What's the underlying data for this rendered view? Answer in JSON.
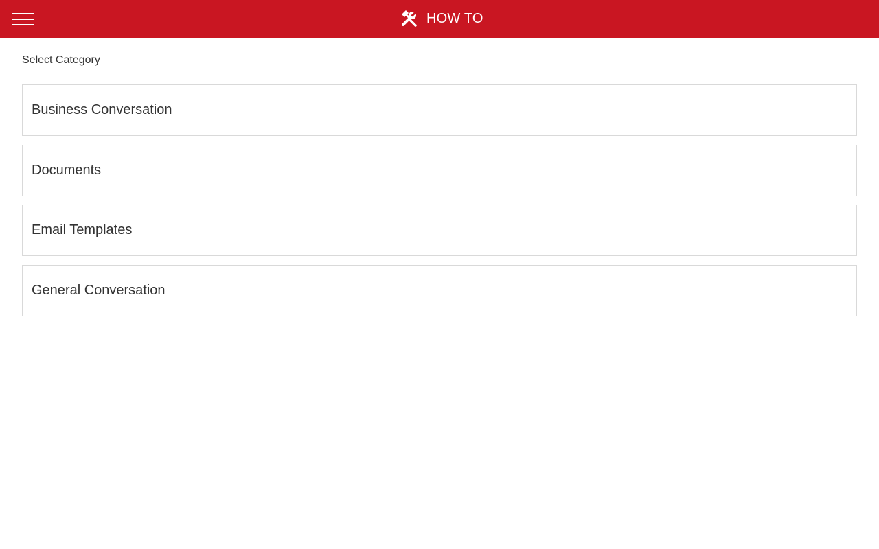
{
  "header": {
    "title": "HOW TO",
    "title_icon": "tools-icon",
    "menu_icon": "hamburger-menu-icon",
    "background_color": "#c91622",
    "text_color": "#ffffff"
  },
  "content": {
    "section_label": "Select Category",
    "categories": [
      {
        "label": "Business Conversation"
      },
      {
        "label": "Documents"
      },
      {
        "label": "Email Templates"
      },
      {
        "label": "General Conversation"
      }
    ]
  }
}
